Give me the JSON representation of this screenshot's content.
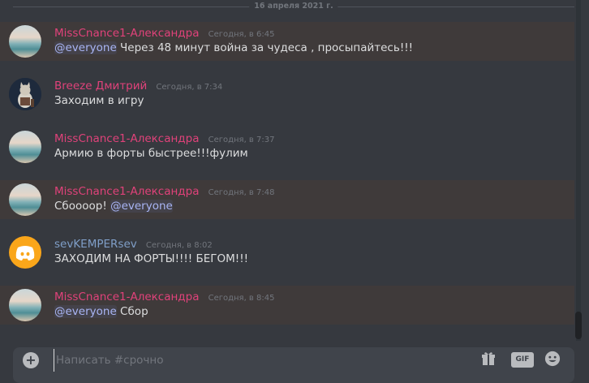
{
  "date_divider": "16 апреля 2021 г.",
  "messages": [
    {
      "author": "MissCnance1-Александра",
      "time": "Сегодня, в 6:45",
      "mention": "@everyone",
      "text": " Через 48 минут война за чудеса , просыпайтесь!!!"
    },
    {
      "author": "Breeze Дмитрий",
      "time": "Сегодня, в 7:34",
      "text": "Заходим в игру"
    },
    {
      "author": "MissCnance1-Александра",
      "time": "Сегодня, в 7:37",
      "text": "Армию в форты быстрее!!!фулим"
    },
    {
      "author": "MissCnance1-Александра",
      "time": "Сегодня, в 7:48",
      "text": "Сбоооор! ",
      "mention": "@everyone"
    },
    {
      "author": "sevKEMPERsev",
      "time": "Сегодня, в 8:02",
      "text": "ЗАХОДИМ НА ФОРТЫ!!!!  БЕГОМ!!!"
    },
    {
      "author": "MissCnance1-Александра",
      "time": "Сегодня, в 8:45",
      "mention": "@everyone",
      "text": " Сбор"
    }
  ],
  "composer": {
    "placeholder": "Написать #срочно",
    "add_symbol": "+",
    "gif_label": "GIF"
  },
  "icons": [
    "plus-icon",
    "gift-icon",
    "gif-icon",
    "emoji-icon"
  ],
  "colors": {
    "background": "#36393f",
    "highlight": "#3f3a3a",
    "author_pink": "#e0427a",
    "author_blue": "#7f9ec7",
    "mention": "#a9b5f5"
  }
}
